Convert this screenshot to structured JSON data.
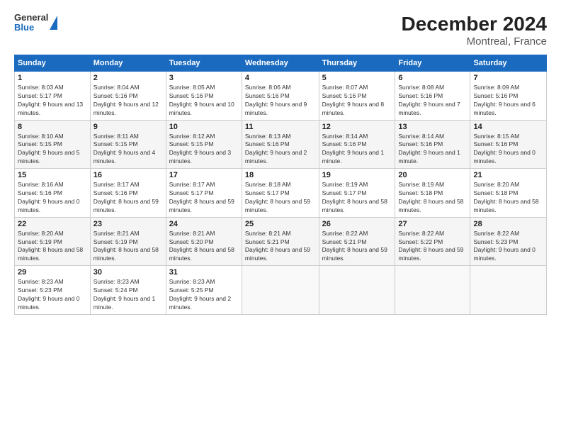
{
  "logo": {
    "line1": "General",
    "line2": "Blue"
  },
  "title": "December 2024",
  "subtitle": "Montreal, France",
  "days_header": [
    "Sunday",
    "Monday",
    "Tuesday",
    "Wednesday",
    "Thursday",
    "Friday",
    "Saturday"
  ],
  "weeks": [
    [
      {
        "day": "1",
        "sunrise": "8:03 AM",
        "sunset": "5:17 PM",
        "daylight": "9 hours and 13 minutes."
      },
      {
        "day": "2",
        "sunrise": "8:04 AM",
        "sunset": "5:16 PM",
        "daylight": "9 hours and 12 minutes."
      },
      {
        "day": "3",
        "sunrise": "8:05 AM",
        "sunset": "5:16 PM",
        "daylight": "9 hours and 10 minutes."
      },
      {
        "day": "4",
        "sunrise": "8:06 AM",
        "sunset": "5:16 PM",
        "daylight": "9 hours and 9 minutes."
      },
      {
        "day": "5",
        "sunrise": "8:07 AM",
        "sunset": "5:16 PM",
        "daylight": "9 hours and 8 minutes."
      },
      {
        "day": "6",
        "sunrise": "8:08 AM",
        "sunset": "5:16 PM",
        "daylight": "9 hours and 7 minutes."
      },
      {
        "day": "7",
        "sunrise": "8:09 AM",
        "sunset": "5:16 PM",
        "daylight": "9 hours and 6 minutes."
      }
    ],
    [
      {
        "day": "8",
        "sunrise": "8:10 AM",
        "sunset": "5:15 PM",
        "daylight": "9 hours and 5 minutes."
      },
      {
        "day": "9",
        "sunrise": "8:11 AM",
        "sunset": "5:15 PM",
        "daylight": "9 hours and 4 minutes."
      },
      {
        "day": "10",
        "sunrise": "8:12 AM",
        "sunset": "5:15 PM",
        "daylight": "9 hours and 3 minutes."
      },
      {
        "day": "11",
        "sunrise": "8:13 AM",
        "sunset": "5:16 PM",
        "daylight": "9 hours and 2 minutes."
      },
      {
        "day": "12",
        "sunrise": "8:14 AM",
        "sunset": "5:16 PM",
        "daylight": "9 hours and 1 minute."
      },
      {
        "day": "13",
        "sunrise": "8:14 AM",
        "sunset": "5:16 PM",
        "daylight": "9 hours and 1 minute."
      },
      {
        "day": "14",
        "sunrise": "8:15 AM",
        "sunset": "5:16 PM",
        "daylight": "9 hours and 0 minutes."
      }
    ],
    [
      {
        "day": "15",
        "sunrise": "8:16 AM",
        "sunset": "5:16 PM",
        "daylight": "9 hours and 0 minutes."
      },
      {
        "day": "16",
        "sunrise": "8:17 AM",
        "sunset": "5:16 PM",
        "daylight": "8 hours and 59 minutes."
      },
      {
        "day": "17",
        "sunrise": "8:17 AM",
        "sunset": "5:17 PM",
        "daylight": "8 hours and 59 minutes."
      },
      {
        "day": "18",
        "sunrise": "8:18 AM",
        "sunset": "5:17 PM",
        "daylight": "8 hours and 59 minutes."
      },
      {
        "day": "19",
        "sunrise": "8:19 AM",
        "sunset": "5:17 PM",
        "daylight": "8 hours and 58 minutes."
      },
      {
        "day": "20",
        "sunrise": "8:19 AM",
        "sunset": "5:18 PM",
        "daylight": "8 hours and 58 minutes."
      },
      {
        "day": "21",
        "sunrise": "8:20 AM",
        "sunset": "5:18 PM",
        "daylight": "8 hours and 58 minutes."
      }
    ],
    [
      {
        "day": "22",
        "sunrise": "8:20 AM",
        "sunset": "5:19 PM",
        "daylight": "8 hours and 58 minutes."
      },
      {
        "day": "23",
        "sunrise": "8:21 AM",
        "sunset": "5:19 PM",
        "daylight": "8 hours and 58 minutes."
      },
      {
        "day": "24",
        "sunrise": "8:21 AM",
        "sunset": "5:20 PM",
        "daylight": "8 hours and 58 minutes."
      },
      {
        "day": "25",
        "sunrise": "8:21 AM",
        "sunset": "5:21 PM",
        "daylight": "8 hours and 59 minutes."
      },
      {
        "day": "26",
        "sunrise": "8:22 AM",
        "sunset": "5:21 PM",
        "daylight": "8 hours and 59 minutes."
      },
      {
        "day": "27",
        "sunrise": "8:22 AM",
        "sunset": "5:22 PM",
        "daylight": "8 hours and 59 minutes."
      },
      {
        "day": "28",
        "sunrise": "8:22 AM",
        "sunset": "5:23 PM",
        "daylight": "9 hours and 0 minutes."
      }
    ],
    [
      {
        "day": "29",
        "sunrise": "8:23 AM",
        "sunset": "5:23 PM",
        "daylight": "9 hours and 0 minutes."
      },
      {
        "day": "30",
        "sunrise": "8:23 AM",
        "sunset": "5:24 PM",
        "daylight": "9 hours and 1 minute."
      },
      {
        "day": "31",
        "sunrise": "8:23 AM",
        "sunset": "5:25 PM",
        "daylight": "9 hours and 2 minutes."
      },
      null,
      null,
      null,
      null
    ]
  ]
}
